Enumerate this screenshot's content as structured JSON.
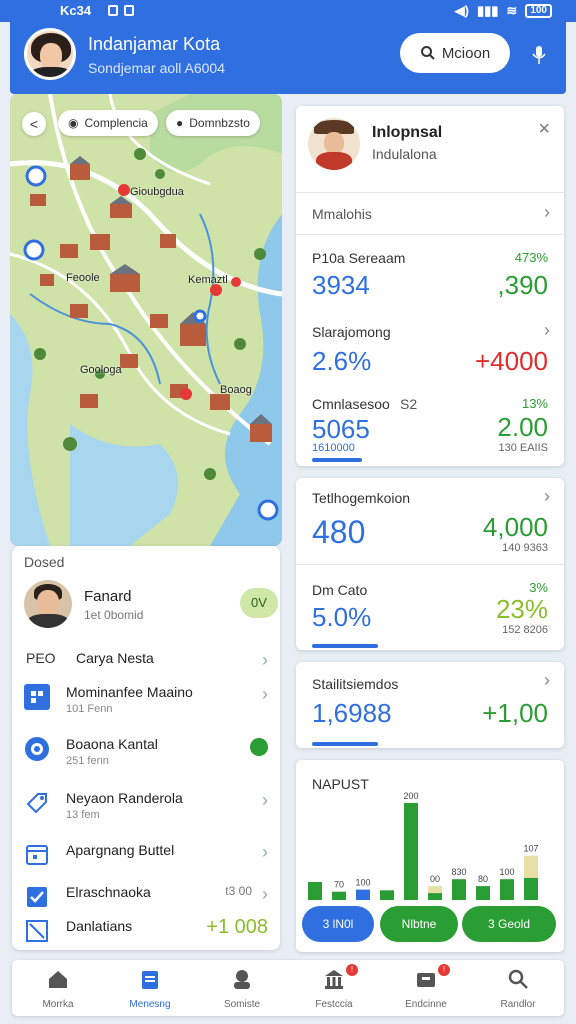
{
  "status_bar": {
    "time": "Kc34",
    "battery": "100"
  },
  "header": {
    "title": "Indanjamar Kota",
    "subtitle": "Sondjemar aoll A6004",
    "search_label": "Mcioon"
  },
  "map": {
    "back_label": "<",
    "chips": [
      {
        "label": "Complencia"
      },
      {
        "label": "Domnbzsto"
      }
    ],
    "labels": [
      "Gioubgdua",
      "Feoole",
      "Kemaztl",
      "Goologa",
      "Boaog"
    ]
  },
  "list_panel": {
    "header": "Dosed",
    "person": {
      "name": "Fanard",
      "subtitle": "1et 0bomid",
      "badge": "0V"
    },
    "rows": [
      {
        "prefix": "PEO",
        "label": "Carya Nesta",
        "sub": ""
      },
      {
        "label": "Mominanfee Maaino",
        "sub": "101 Fenn"
      },
      {
        "label": "Boaona Kantal",
        "sub": "251 fenn"
      },
      {
        "label": "Neyaon Randerola",
        "sub": "13 fem"
      },
      {
        "label": "Apargnang Buttel",
        "sub": ""
      },
      {
        "label": "Elraschnaoka",
        "value": "t3 00"
      },
      {
        "label": "Danlatians",
        "value": "+1 008"
      }
    ]
  },
  "profile_card": {
    "title": "Inlopnsal",
    "subtitle": "Indulalona",
    "close": "×"
  },
  "stats_card": {
    "header": "Mmalohis",
    "items": [
      {
        "label": "P10a Sereaam",
        "value": "3934",
        "right_small": "473%",
        "right_big": ",390"
      },
      {
        "label": "Slarajomong",
        "value": "2.6%",
        "right_big": "+4000"
      },
      {
        "label": "Cmnlasesoo",
        "label_suffix": "S2",
        "value": "5065",
        "sub": "1610000",
        "right_small": "13%",
        "right_big": "2.00",
        "right_sub": "130 EAIIS"
      }
    ]
  },
  "card2": {
    "header": "Tetlhogemkoion",
    "value1": "480",
    "right_big1": "4,000",
    "right_sub1": "140 9363",
    "label2": "Dm Cato",
    "value2": "5.0%",
    "right_small2": "3%",
    "right_big2": "23%",
    "right_sub2": "152 8206"
  },
  "card3": {
    "header": "Stailitsiemdos",
    "value": "1,6988",
    "right_big": "+1,00"
  },
  "chart_card": {
    "title": "NAPUST",
    "buttons": [
      {
        "label": "3 lN0l"
      },
      {
        "label": "Nlbtne"
      },
      {
        "label": "3 Geold"
      }
    ]
  },
  "chart_data": {
    "type": "bar",
    "title": "NAPUST",
    "series": [
      {
        "values": [
          52,
          24,
          30,
          28,
          280,
          20,
          60,
          40,
          60,
          64
        ]
      },
      {
        "values": [
          0,
          0,
          0,
          0,
          0,
          20,
          0,
          0,
          0,
          64
        ]
      }
    ],
    "data_labels": [
      "",
      "70",
      "100",
      "",
      "200",
      "00",
      "830",
      "80",
      "100",
      "107"
    ],
    "ylim": [
      0,
      300
    ],
    "grid": false,
    "legend": "none"
  },
  "bottom_nav": [
    {
      "label": "Morrka",
      "active": false
    },
    {
      "label": "Menesng",
      "active": true
    },
    {
      "label": "Somiste",
      "active": false
    },
    {
      "label": "Festccia",
      "active": false
    },
    {
      "label": "Endcinne",
      "active": false
    },
    {
      "label": "Randlor",
      "active": false
    }
  ],
  "colors": {
    "primary": "#2f6fe0",
    "positive": "#2a9d34",
    "negative": "#e02c2c",
    "lime": "#8bbd2c"
  }
}
